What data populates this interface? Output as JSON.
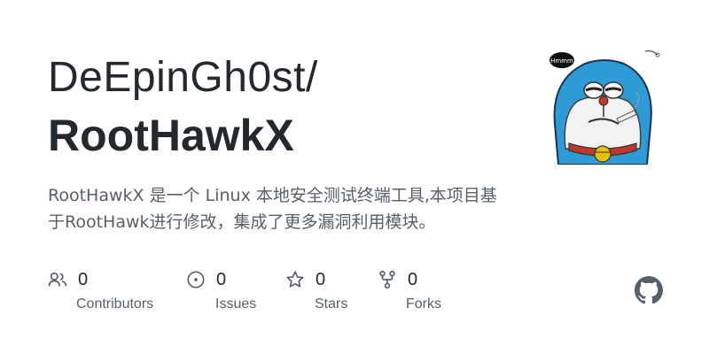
{
  "repo_card": {
    "owner": "DeEpinGh0st/",
    "name": "RootHawkX",
    "description": "RootHawkX 是一个 Linux 本地安全测试终端工具,本项目基于RootHawk进行修改，集成了更多漏洞利用模块。"
  },
  "avatar": {
    "icon": "doraemon-avatar",
    "badge_text": "Hmmm"
  },
  "stats": {
    "contributors": {
      "value": "0",
      "label": "Contributors",
      "icon": "people-icon"
    },
    "issues": {
      "value": "0",
      "label": "Issues",
      "icon": "issue-circle-icon"
    },
    "stars": {
      "value": "0",
      "label": "Stars",
      "icon": "star-icon"
    },
    "forks": {
      "value": "0",
      "label": "Forks",
      "icon": "fork-icon"
    }
  },
  "brand": {
    "icon": "github-logo-icon",
    "color": "#57606a"
  },
  "colors": {
    "title": "#24292f",
    "muted": "#57606a",
    "background": "#ffffff"
  }
}
